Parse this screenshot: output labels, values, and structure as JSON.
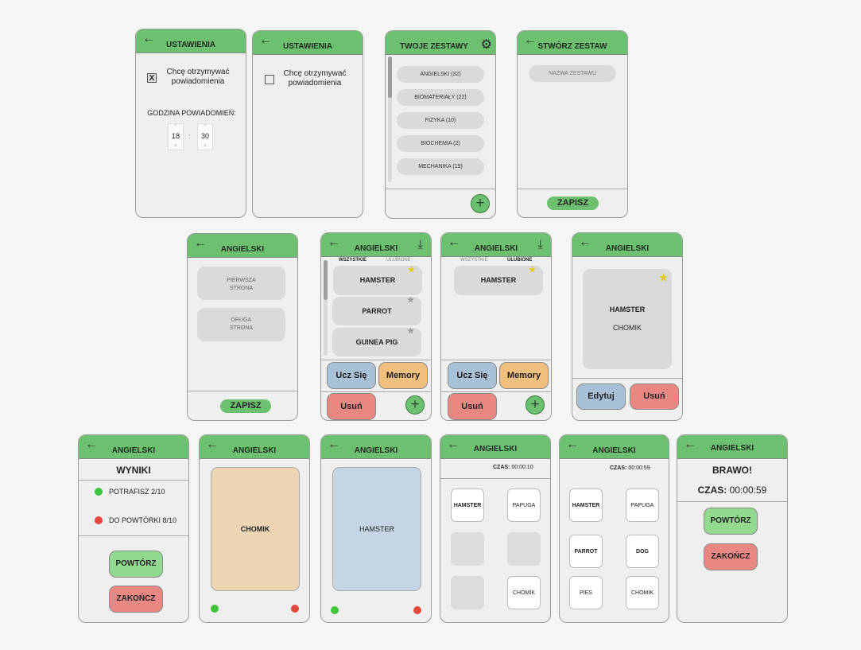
{
  "colors": {
    "header": "#6cc070",
    "blue": "#a9c0d9",
    "orange": "#f1bf7e",
    "red": "#e98883",
    "star_active": "#e6c619",
    "star_inactive": "#9a9a9a"
  },
  "icons": {
    "back": "arrow-left-icon",
    "gear": "gear-icon",
    "download": "arrow-down-icon",
    "plus": "plus-icon",
    "star": "star-icon"
  },
  "settings_on": {
    "title": "USTAWIENIA",
    "checkbox_mark": "X",
    "checkbox_label_1": "Chcę otrzymywać",
    "checkbox_label_2": "powiadomienia",
    "checked": true,
    "time_label": "GODZINA POWIADOMIEŃ:",
    "hour": "18",
    "minute": "30",
    "separator": ":",
    "up": "^",
    "down": "v"
  },
  "settings_off": {
    "title": "USTAWIENIA",
    "checkbox_label_1": "Chcę otrzymywać",
    "checkbox_label_2": "powiadomienia",
    "checked": false
  },
  "sets": {
    "title": "TWOJE ZESTAWY",
    "items": [
      "ANGIELSKI (32)",
      "BIOMATERIAŁY (22)",
      "FIZYKA (10)",
      "BIOCHEMIA (2)",
      "MECHANIKA (19)"
    ],
    "plus": "+"
  },
  "create": {
    "title": "STWÓRZ ZESTAW",
    "placeholder": "NAZWA ZESTAWU",
    "save": "ZAPISZ"
  },
  "edit_card": {
    "title": "ANGIELSKI",
    "front_1": "PIERWSZA",
    "front_2": "STRONA",
    "back_1": "DRUGA",
    "back_2": "STRONA",
    "save": "ZAPISZ"
  },
  "list_all": {
    "title": "ANGIELSKI",
    "tab_all": "WSZYSTKIE",
    "tab_fav": "ULUBIONE",
    "cards": [
      {
        "word": "HAMSTER",
        "fav": true
      },
      {
        "word": "PARROT",
        "fav": false
      },
      {
        "word": "GUINEA PIG",
        "fav": false
      }
    ],
    "learn": "Ucz Się",
    "memory": "Memory",
    "delete": "Usuń",
    "plus": "+",
    "star": "★"
  },
  "list_fav": {
    "title": "ANGIELSKI",
    "tab_all": "WSZYSTKIE",
    "tab_fav": "ULUBIONE",
    "cards": [
      {
        "word": "HAMSTER",
        "fav": true
      }
    ],
    "learn": "Ucz Się",
    "memory": "Memory",
    "delete": "Usuń",
    "plus": "+"
  },
  "card_detail": {
    "title": "ANGIELSKI",
    "word": "HAMSTER",
    "translation": "CHOMIK",
    "edit": "Edytuj",
    "delete": "Usuń"
  },
  "results": {
    "title": "ANGIELSKI",
    "heading": "WYNIKI",
    "known": "POTRAFISZ 2/10",
    "review": "DO POWTÓRKI 8/10",
    "repeat": "POWTÓRZ",
    "finish": "ZAKOŃCZ"
  },
  "learn_back": {
    "title": "ANGIELSKI",
    "text": "CHOMIK"
  },
  "learn_front": {
    "title": "ANGIELSKI",
    "text": "HAMSTER"
  },
  "memory_1": {
    "title": "ANGIELSKI",
    "time_label": "CZAS:",
    "time": "00:00:10",
    "tiles": [
      "HAMSTER",
      "PAPUGA",
      "",
      "",
      "",
      "CHOMIK"
    ]
  },
  "memory_2": {
    "title": "ANGIELSKI",
    "time_label": "CZAS:",
    "time": "00:00:59",
    "tiles": [
      "HAMSTER",
      "PAPUGA",
      "PARROT",
      "DOG",
      "PIES",
      "CHOMIK"
    ]
  },
  "done": {
    "title": "ANGIELSKI",
    "heading": "BRAWO!",
    "time_label": "CZAS:",
    "time": "00:00:59",
    "repeat": "POWTÓRZ",
    "finish": "ZAKOŃCZ"
  }
}
